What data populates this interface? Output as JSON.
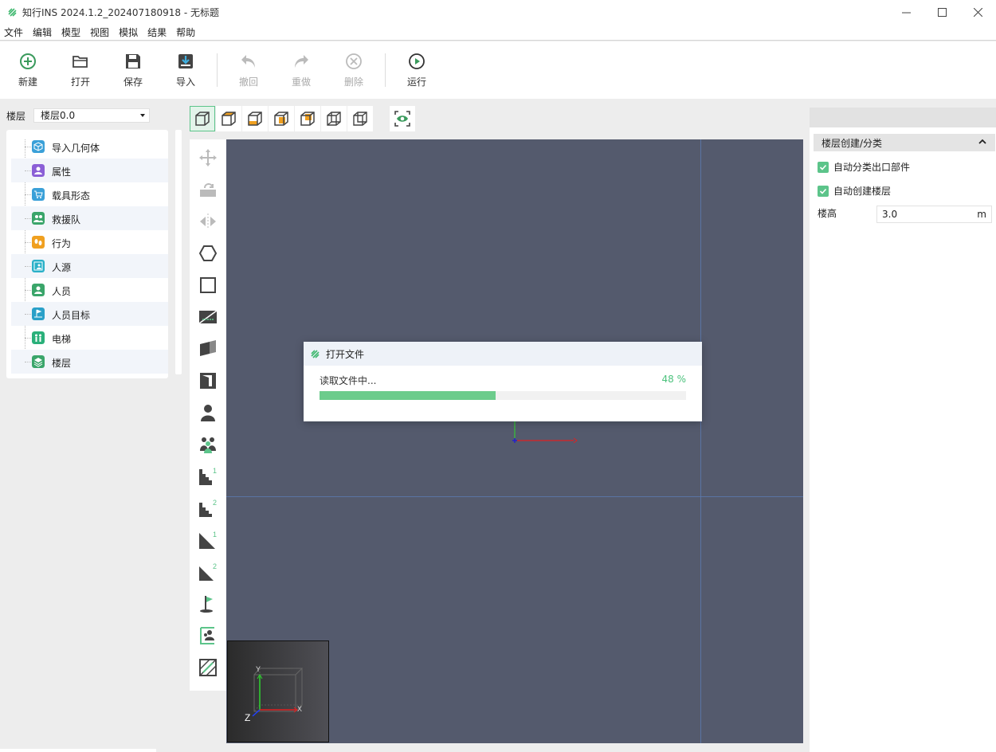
{
  "window": {
    "title": "知行INS 2024.1.2_202407180918 - 无标题"
  },
  "menu": [
    "文件",
    "编辑",
    "模型",
    "视图",
    "模拟",
    "结果",
    "帮助"
  ],
  "toolbar": {
    "new": "新建",
    "open": "打开",
    "save": "保存",
    "import": "导入",
    "undo": "撤回",
    "redo": "重做",
    "delete": "删除",
    "run": "运行"
  },
  "floor": {
    "label": "楼层",
    "selected": "楼层0.0"
  },
  "tree": [
    {
      "label": "导入几何体",
      "color": "#3aa0d8"
    },
    {
      "label": "属性",
      "color": "#8b5fd6"
    },
    {
      "label": "载具形态",
      "color": "#3aa0d8"
    },
    {
      "label": "救援队",
      "color": "#3aa56a"
    },
    {
      "label": "行为",
      "color": "#f0a020"
    },
    {
      "label": "人源",
      "color": "#2ab0c8"
    },
    {
      "label": "人员",
      "color": "#3aa56a"
    },
    {
      "label": "人员目标",
      "color": "#2aa0c8"
    },
    {
      "label": "电梯",
      "color": "#2ab07a"
    },
    {
      "label": "楼层",
      "color": "#3aa56a"
    }
  ],
  "dialog": {
    "title": "打开文件",
    "status": "读取文件中...",
    "percent_text": "48 %",
    "progress": 0.48
  },
  "right": {
    "section": "楼层创建/分类",
    "check1": "自动分类出口部件",
    "check2": "自动创建楼层",
    "height_label": "楼高",
    "height_value": "3.0",
    "height_unit": "m"
  },
  "minimap": {
    "y": "Y",
    "x": "X",
    "z": "Z"
  },
  "colors": {
    "accent": "#5cc48a",
    "viewport": "#545a6d"
  }
}
